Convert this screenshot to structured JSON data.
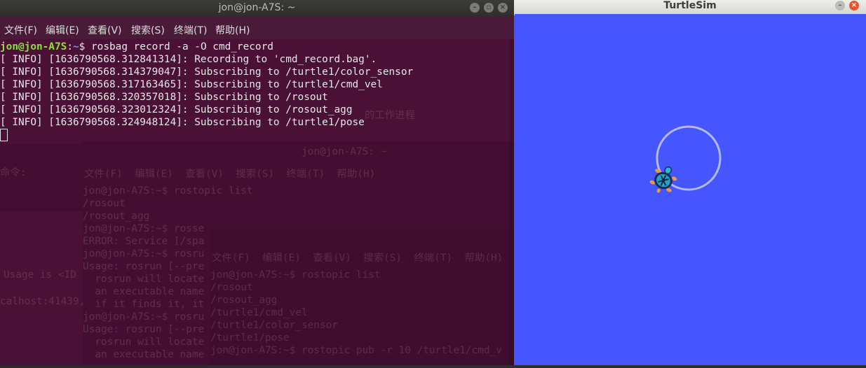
{
  "terminal": {
    "title": "jon@jon-A7S: ~",
    "window_buttons": [
      "–",
      "▫",
      "×"
    ],
    "menu": [
      "文件(F)",
      "编辑(E)",
      "查看(V)",
      "搜索(S)",
      "终端(T)",
      "帮助(H)"
    ],
    "prompt_user": "jon@jon-A7S",
    "prompt_sep": ":",
    "prompt_path": "~",
    "prompt_symbol": "$",
    "command": "rosbag record -a -O cmd_record",
    "output": [
      "[ INFO] [1636790568.312841314]: Recording to 'cmd_record.bag'.",
      "[ INFO] [1636790568.314379047]: Subscribing to /turtle1/color_sensor",
      "[ INFO] [1636790568.317163465]: Subscribing to /turtle1/cmd_vel",
      "[ INFO] [1636790568.320357018]: Subscribing to /rosout",
      "[ INFO] [1636790568.323012324]: Subscribing to /rosout_agg",
      "[ INFO] [1636790568.324948124]: Subscribing to /turtle1/pose"
    ],
    "ghost_lines_a": [
      "jon@jon-A7S:~$ rostopic list",
      "/rosout",
      "/rosout_agg",
      "jon@jon-A7S:~$ rosse",
      "ERROR: Service [/spa",
      "jon@jon-A7S:~$ rosru",
      "Usage: rosrun [--pre",
      "  rosrun will locate",
      "  an executable name",
      "  if it finds it, it",
      "jon@jon-A7S:~$ rosru",
      "Usage: rosrun [--pre",
      "  rosrun will locate",
      "  an executable name"
    ],
    "ghost_lines_b": [
      "jon@jon-A7S:~$ rostopic list",
      "/rosout",
      "/rosout_agg",
      "/turtle1/cmd_vel",
      "/turtle1/color_sensor",
      "/turtle1/pose",
      "jon@jon-A7S:~$ rostopic pub -r 10 /turtle1/cmd_v"
    ],
    "ghost_left": [
      "命令:",
      "Usage is <ID",
      "calhost:41439,"
    ],
    "ghost_menu_b": "文件(F)  编辑(E)  查看(V)  搜索(S)  终端(T)  帮助(H)",
    "ghost_menu_a": "文件(F)  编辑(E)  查看(V)  搜索(S)  终端(T)  帮助(H)",
    "ghost_text_top": "的工作进程",
    "ghost_text_title": "jon@jon-A7S: ~"
  },
  "turtlesim": {
    "title": "TurtleSim",
    "background_color": "#4556ff",
    "path_color": "#b4b8ff",
    "turtle_color": "#1fa3c7"
  }
}
